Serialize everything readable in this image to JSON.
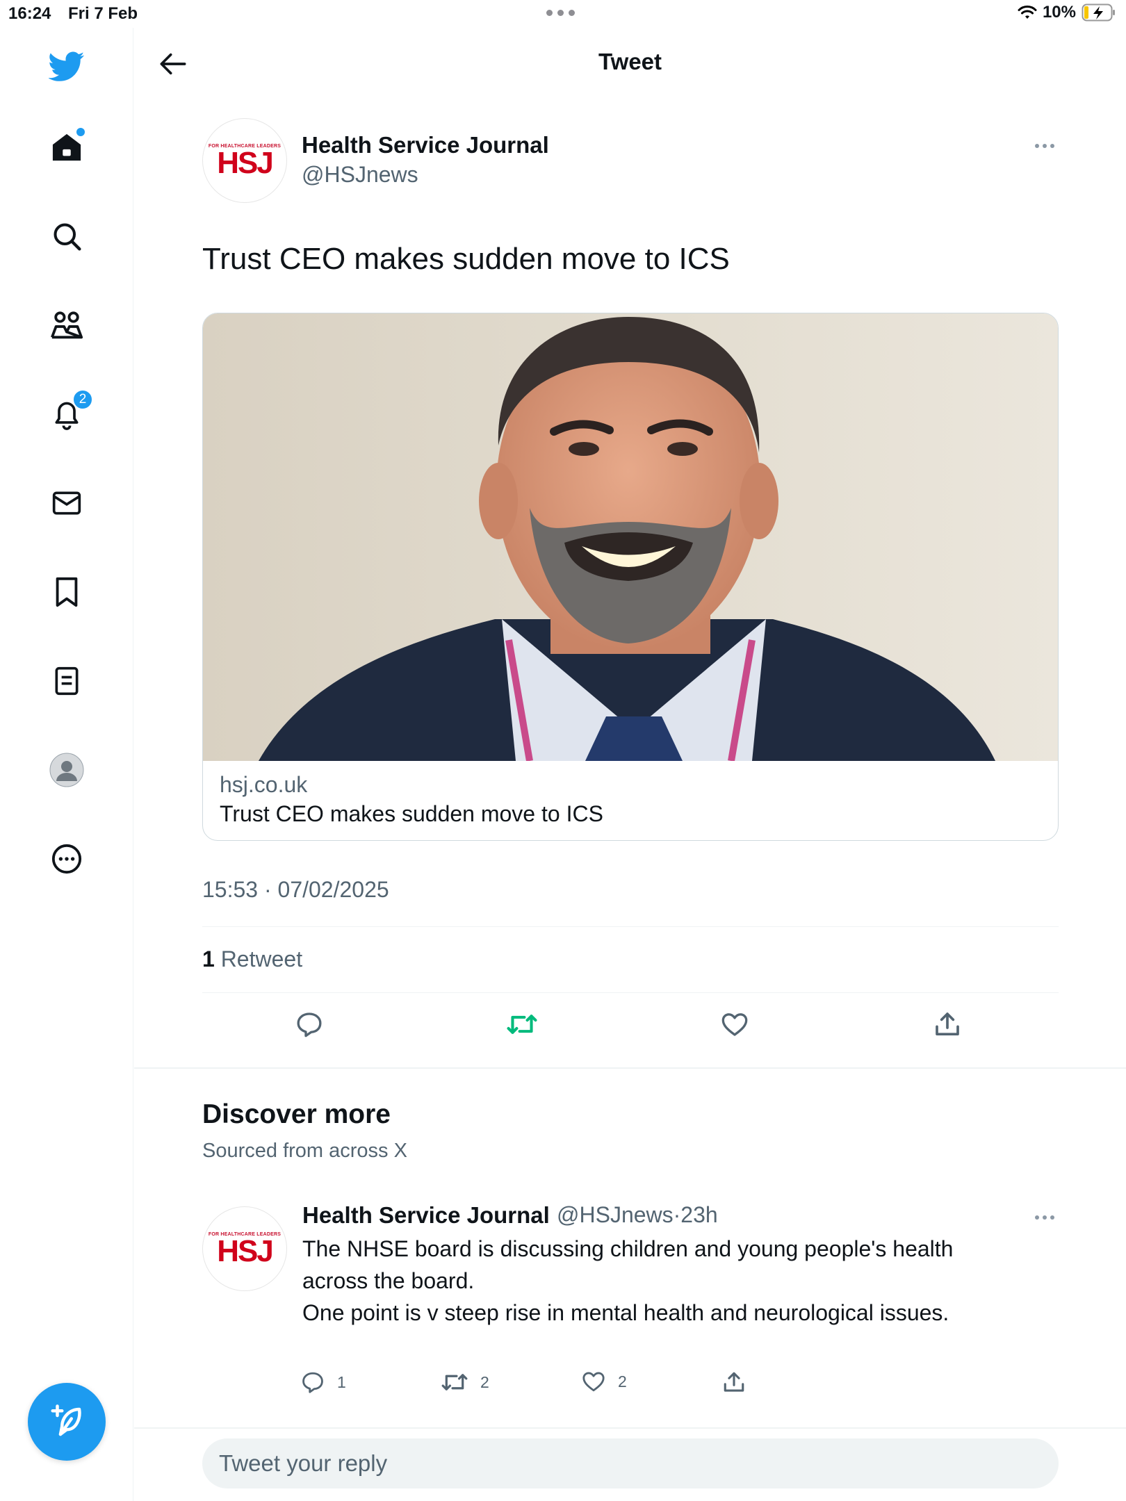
{
  "status_bar": {
    "time": "16:24",
    "date": "Fri 7 Feb",
    "battery": "10%"
  },
  "sidebar": {
    "items": [
      {
        "icon": "twitter-bird-icon"
      },
      {
        "icon": "home-icon",
        "has_dot": true
      },
      {
        "icon": "search-icon"
      },
      {
        "icon": "communities-icon"
      },
      {
        "icon": "bell-icon",
        "badge": "2"
      },
      {
        "icon": "mail-icon"
      },
      {
        "icon": "bookmark-icon"
      },
      {
        "icon": "lists-icon"
      },
      {
        "icon": "profile-avatar-icon"
      },
      {
        "icon": "more-circle-icon"
      }
    ],
    "compose_icon": "feather-plus-icon"
  },
  "header": {
    "title": "Tweet"
  },
  "tweet": {
    "author_name": "Health Service Journal",
    "author_handle": "@HSJnews",
    "avatar_logo": "HSJ",
    "avatar_tagline": "FOR HEALTHCARE LEADERS",
    "text": "Trust CEO makes sudden move to ICS",
    "card": {
      "domain": "hsj.co.uk",
      "title": "Trust CEO makes sudden move to ICS"
    },
    "timestamp": "15:53 · 07/02/2025",
    "retweet_count": "1",
    "retweet_label": "Retweet"
  },
  "discover": {
    "title": "Discover more",
    "subtitle": "Sourced from across X",
    "tweets": [
      {
        "author_name": "Health Service Journal",
        "author_handle": "@HSJnews",
        "time": "23h",
        "line1": "The NHSE board is discussing children and young people's health",
        "line2": "across the board.",
        "line3": "One point is v steep rise in mental health and neurological issues.",
        "replies": "1",
        "retweets": "2",
        "likes": "2"
      }
    ]
  },
  "reply": {
    "placeholder": "Tweet your reply"
  },
  "colors": {
    "accent": "#1d9bf0",
    "retweet_green": "#00ba7c",
    "muted": "#536471",
    "hsj_red": "#d0021b"
  }
}
